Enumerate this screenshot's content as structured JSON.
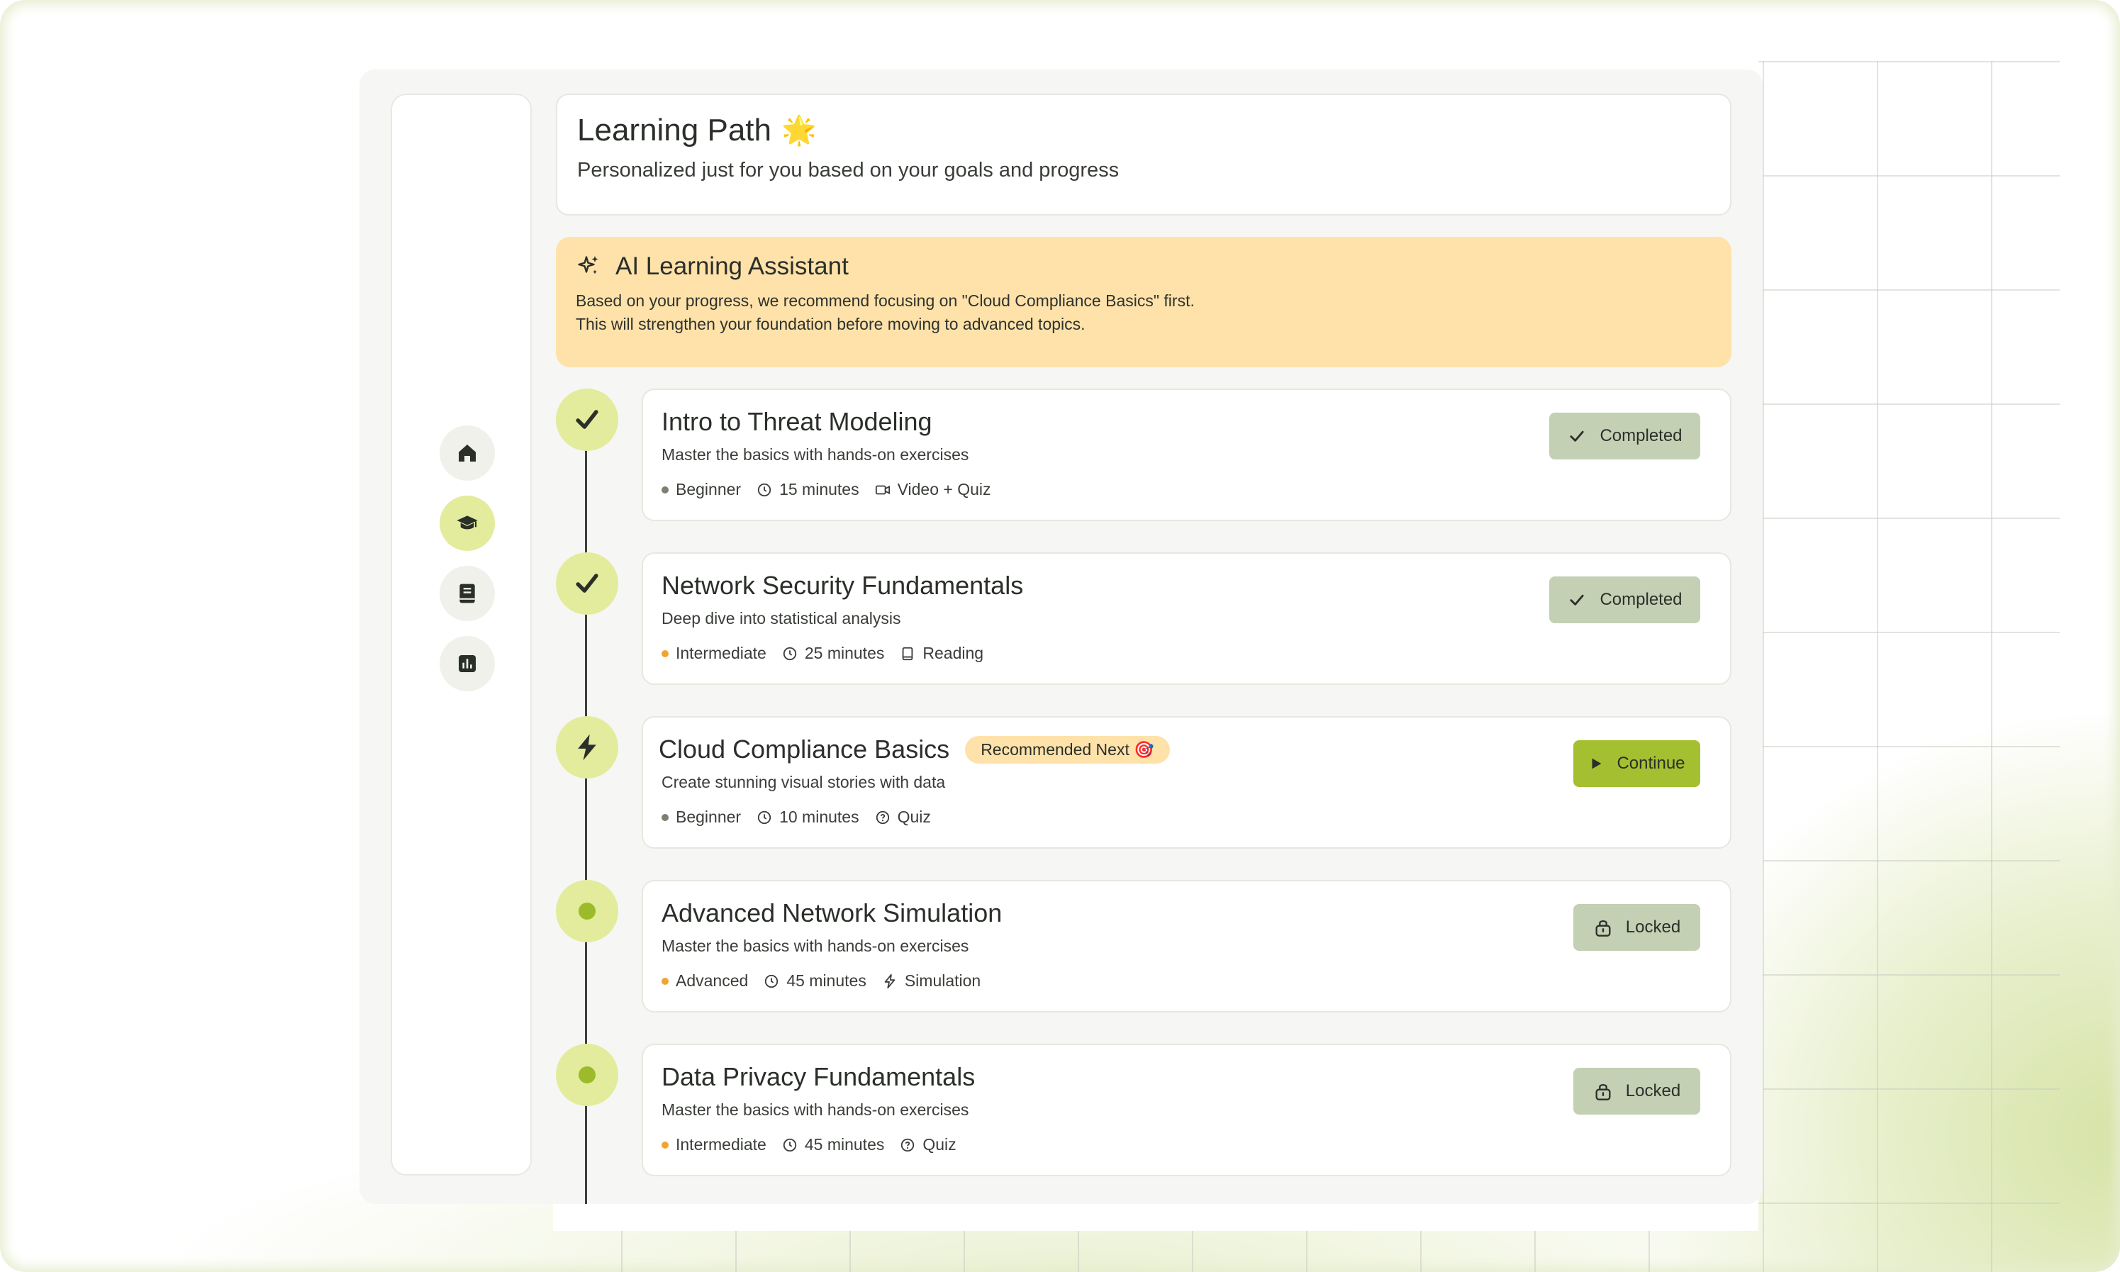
{
  "header": {
    "title": "Learning Path",
    "title_emoji": "🌟",
    "subtitle": "Personalized just for you based on your goals and progress"
  },
  "sidebar": {
    "items": [
      {
        "icon": "home-icon"
      },
      {
        "icon": "graduation-cap-icon",
        "active": true
      },
      {
        "icon": "book-icon"
      },
      {
        "icon": "bar-chart-icon"
      }
    ]
  },
  "assistant": {
    "title": "AI Learning Assistant",
    "line1": "Based on your progress, we recommend focusing on \"Cloud Compliance Basics\" first.",
    "line2": "This will strengthen your foundation before moving to advanced topics."
  },
  "lessons": [
    {
      "title": "Intro to Threat Modeling",
      "description": "Master the basics with hands-on exercises",
      "level": "Beginner",
      "duration": "15 minutes",
      "format": "Video + Quiz",
      "status": "Completed"
    },
    {
      "title": "Network Security Fundamentals",
      "description": "Deep dive into statistical analysis",
      "level": "Intermediate",
      "duration": "25 minutes",
      "format": "Reading",
      "status": "Completed"
    },
    {
      "title": "Cloud Compliance Basics",
      "badge": "Recommended Next 🎯",
      "description": "Create stunning visual stories with data",
      "level": "Beginner",
      "duration": "10 minutes",
      "format": "Quiz",
      "status": "Continue"
    },
    {
      "title": "Advanced Network Simulation",
      "description": "Master the basics with hands-on exercises",
      "level": "Advanced",
      "duration": "45 minutes",
      "format": "Simulation",
      "status": "Locked"
    },
    {
      "title": "Data Privacy Fundamentals",
      "description": "Master the basics with hands-on exercises",
      "level": "Intermediate",
      "duration": "45 minutes",
      "format": "Quiz",
      "status": "Locked"
    }
  ],
  "colors": {
    "accent": "#a4c030",
    "level_beginner": "#7b8071",
    "level_intermediate": "#f2a52e",
    "level_advanced": "#f2a52e"
  }
}
